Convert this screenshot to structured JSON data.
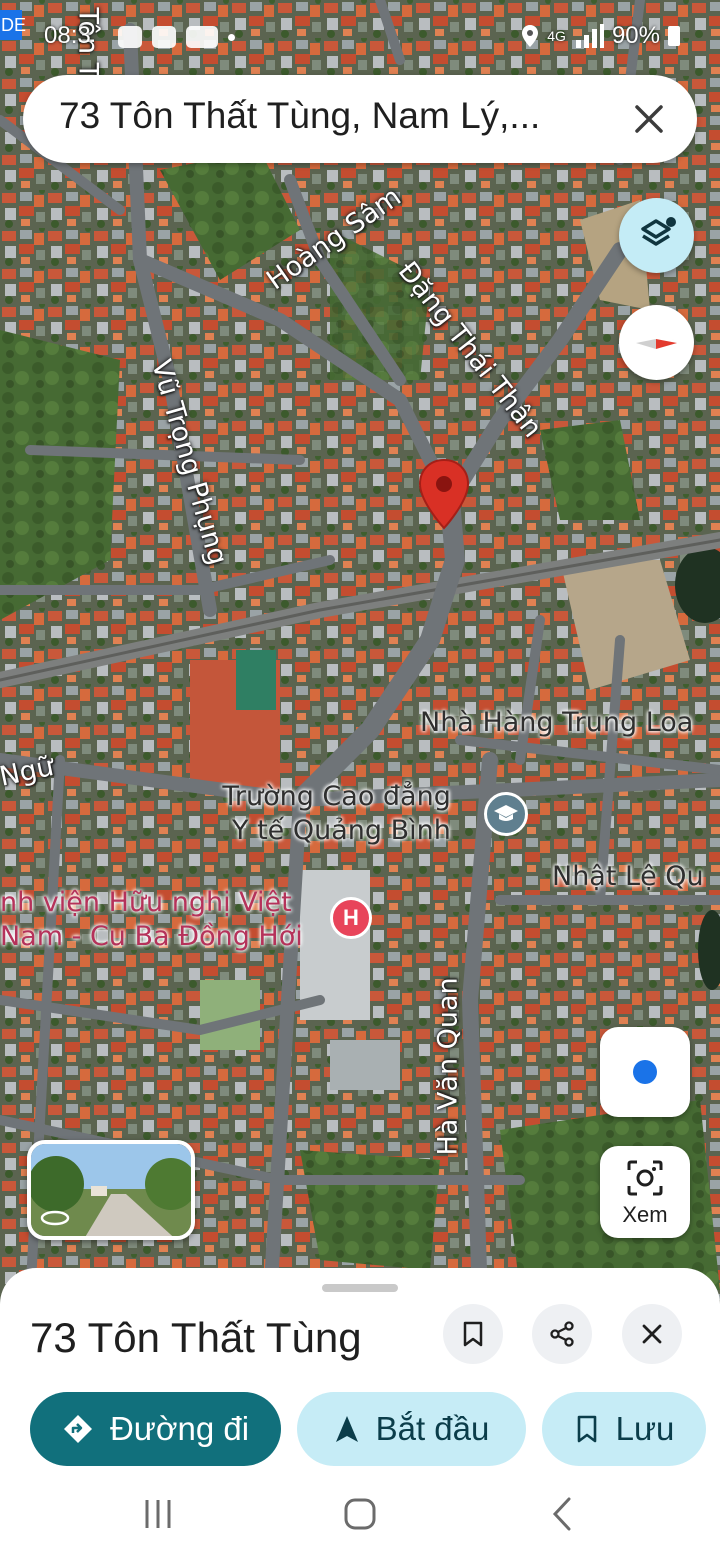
{
  "status_bar": {
    "carrier_tag": "DE",
    "time": "08:3",
    "network": "4G",
    "battery": "90%"
  },
  "search": {
    "query": "73 Tôn Thất Tùng, Nam Lý,...",
    "clear_icon": "close-icon"
  },
  "map": {
    "streets": [
      {
        "label": "Tôn Th"
      },
      {
        "label": "Hoàng Sâm"
      },
      {
        "label": "Đặng Thái Thân"
      },
      {
        "label": "Vũ Trọng Phụng"
      },
      {
        "label": "Ngữ"
      },
      {
        "label": "Hà Văn Quan"
      }
    ],
    "pois": {
      "restaurant": "Nhà Hàng Trung Loa",
      "college_line1": "Trường Cao đẳng",
      "college_line2": "Y tế Quảng Bình",
      "nhat_le": "Nhật Lệ Qu",
      "hospital_line1": "nh viện Hữu nghị Việt",
      "hospital_line2": "Nam - Cu Ba Đồng Hới",
      "hospital_marker": "H"
    }
  },
  "controls": {
    "layers_icon": "layers-icon",
    "compass_icon": "compass-icon",
    "location_icon": "my-location-icon",
    "lens_label": "Xem"
  },
  "place": {
    "title": "73 Tôn Thất Tùng",
    "actions": {
      "directions": "Đường đi",
      "start": "Bắt đầu",
      "save": "Lưu"
    }
  },
  "colors": {
    "primary": "#11707c",
    "secondary": "#c6ecf6",
    "pin": "#d93025"
  }
}
